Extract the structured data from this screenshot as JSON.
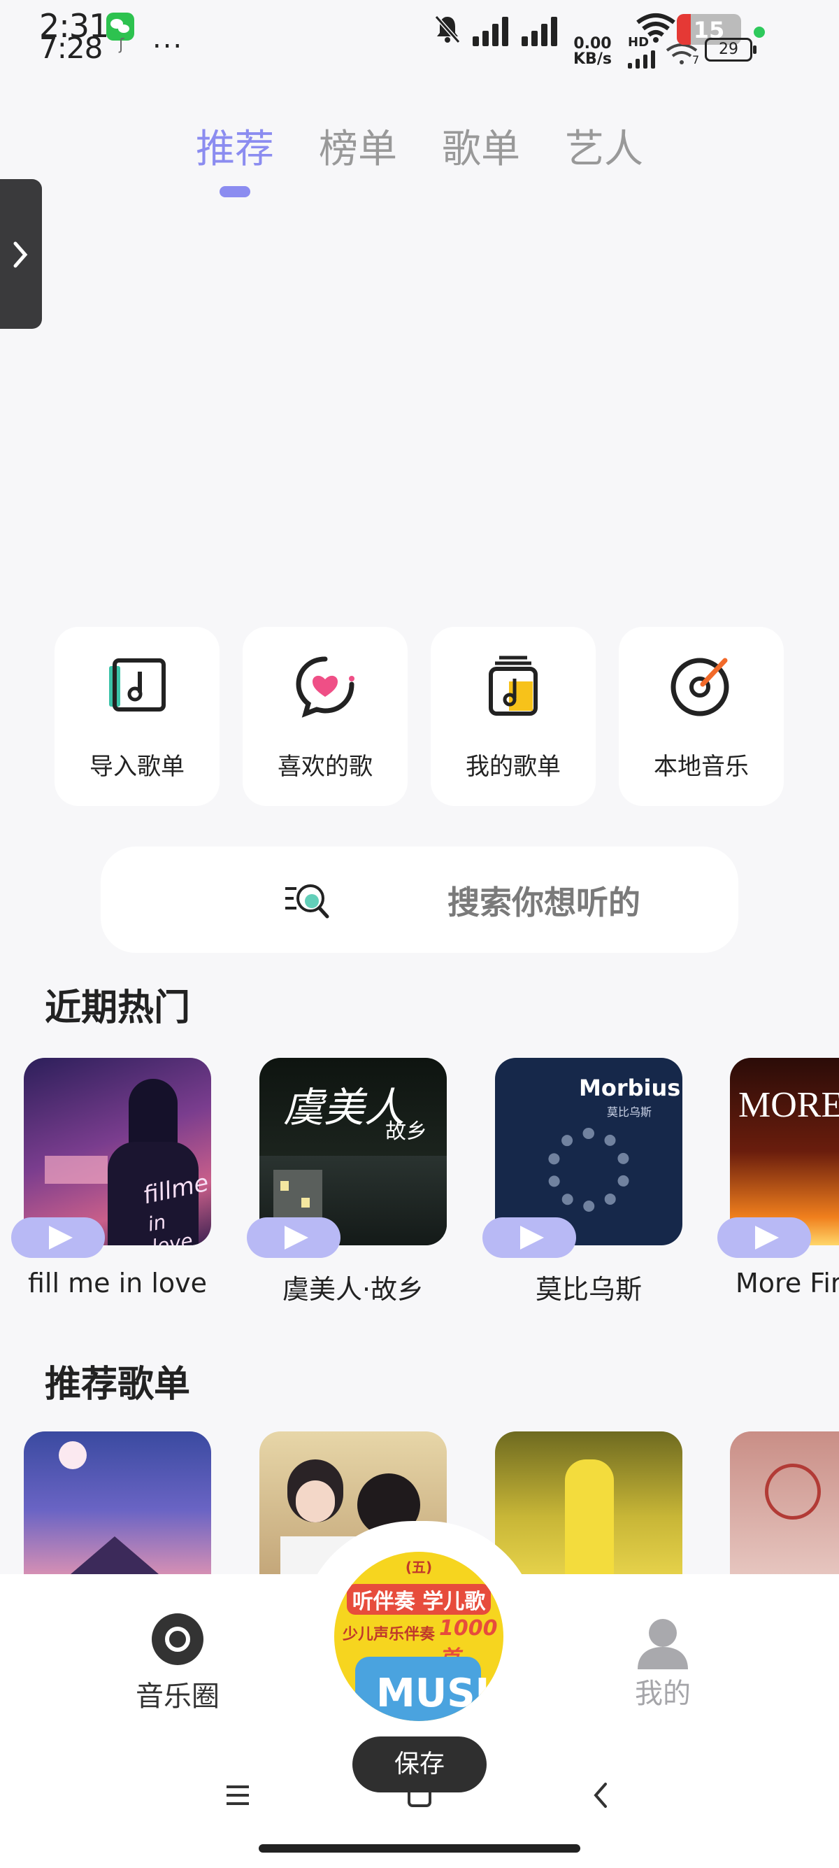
{
  "status_bar": {
    "time_primary": "2:31",
    "time_secondary": "7:28",
    "more": "...",
    "net_speed_value": "0.00",
    "net_speed_unit": "KB/s",
    "hd": "HD",
    "battery_level_a": "15",
    "battery_level_b": "29",
    "signal_sub": "7"
  },
  "tabs": [
    {
      "label": "推荐",
      "active": true
    },
    {
      "label": "榜单",
      "active": false
    },
    {
      "label": "歌单",
      "active": false
    },
    {
      "label": "艺人",
      "active": false
    }
  ],
  "quick_actions": [
    {
      "label": "导入歌单",
      "icon": "import-playlist-icon"
    },
    {
      "label": "喜欢的歌",
      "icon": "liked-songs-heart-icon"
    },
    {
      "label": "我的歌单",
      "icon": "my-playlist-icon"
    },
    {
      "label": "本地音乐",
      "icon": "local-music-disc-icon"
    }
  ],
  "search": {
    "placeholder": "搜索你想听的",
    "icon": "search-icon"
  },
  "sections": {
    "hot": {
      "title": "近期热门",
      "items": [
        {
          "name": "fill me in love",
          "cover_text": "fill me in love"
        },
        {
          "name": "虞美人·故乡",
          "cover_text": "虞美人 故乡"
        },
        {
          "name": "莫比乌斯",
          "cover_text": "Morbius",
          "cover_sub": "莫比乌斯"
        },
        {
          "name": "More Fir",
          "cover_text": "MORE F"
        }
      ]
    },
    "playlists": {
      "title": "推荐歌单"
    }
  },
  "bottom_nav": {
    "music_circle": "音乐圈",
    "mine": "我的",
    "now_playing_cover_top": "听伴奏 学儿歌",
    "now_playing_cover_sub": "少儿声乐伴奏",
    "now_playing_cover_num": "1000首",
    "now_playing_cover_badge": "(五)"
  },
  "toast": {
    "label": "保存"
  },
  "colors": {
    "accent": "#8b8cf0",
    "play_pill": "#b8b9f5",
    "background": "#f7f7f9"
  }
}
